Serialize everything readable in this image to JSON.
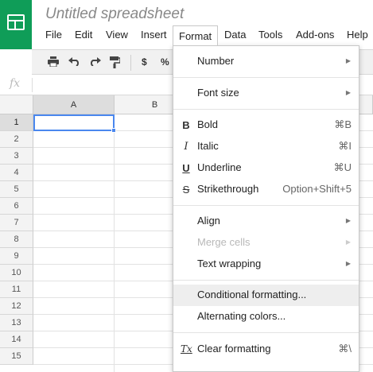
{
  "app": {
    "title": "Untitled spreadsheet"
  },
  "menubar": {
    "items": [
      "File",
      "Edit",
      "View",
      "Insert",
      "Format",
      "Data",
      "Tools",
      "Add-ons",
      "Help"
    ],
    "open": "Format"
  },
  "toolbar": {
    "currency_label": "$",
    "percent_label": "%"
  },
  "formula": {
    "fx_label": "fx",
    "value": ""
  },
  "grid": {
    "columns": [
      "A",
      "B"
    ],
    "rows": [
      "1",
      "2",
      "3",
      "4",
      "5",
      "6",
      "7",
      "8",
      "9",
      "10",
      "11",
      "12",
      "13",
      "14",
      "15"
    ],
    "selected_cell": "A1"
  },
  "format_menu": {
    "number": "Number",
    "font_size": "Font size",
    "bold": "Bold",
    "bold_icon": "B",
    "bold_shortcut": "⌘B",
    "italic": "Italic",
    "italic_icon": "I",
    "italic_shortcut": "⌘I",
    "underline": "Underline",
    "underline_icon": "U",
    "underline_shortcut": "⌘U",
    "strikethrough": "Strikethrough",
    "strikethrough_icon": "S",
    "strikethrough_shortcut": "Option+Shift+5",
    "align": "Align",
    "merge_cells": "Merge cells",
    "text_wrapping": "Text wrapping",
    "conditional_formatting": "Conditional formatting...",
    "alternating_colors": "Alternating colors...",
    "clear_formatting": "Clear formatting",
    "clear_icon": "Tx",
    "clear_shortcut": "⌘\\"
  },
  "colors": {
    "brand": "#0f9d58",
    "selection": "#4a87ee",
    "highlight": "#eeeeee"
  }
}
